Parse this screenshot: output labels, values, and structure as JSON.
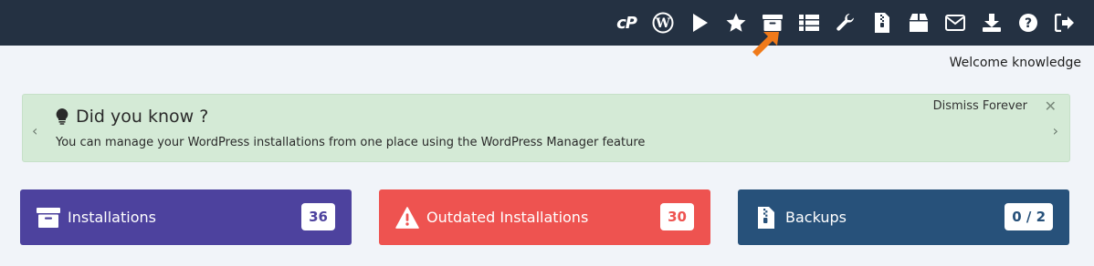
{
  "toolbar": {
    "icons": [
      "cpanel-icon",
      "wordpress-icon",
      "play-icon",
      "star-icon",
      "archive-icon",
      "list-icon",
      "wrench-icon",
      "zip-file-icon",
      "box-icon",
      "envelope-icon",
      "download-icon",
      "help-icon",
      "logout-icon"
    ],
    "cpanel_text": "cP"
  },
  "welcome_text": "Welcome knowledge",
  "notice": {
    "title": "Did you know ?",
    "message": "You can manage your WordPress installations from one place using the WordPress Manager feature",
    "dismiss_label": "Dismiss Forever",
    "close_glyph": "✕",
    "prev_glyph": "‹",
    "next_glyph": "›"
  },
  "cards": {
    "installations": {
      "label": "Installations",
      "count": "36",
      "color": "#4d429e"
    },
    "outdated": {
      "label": "Outdated Installations",
      "count": "30",
      "color": "#ee5350"
    },
    "backups": {
      "label": "Backups",
      "count": "0 / 2",
      "color": "#27517a"
    }
  },
  "colors": {
    "topbar": "#243142",
    "background": "#f1f4f9",
    "notice_bg": "#d4ead6",
    "arrow": "#f07a1a"
  }
}
